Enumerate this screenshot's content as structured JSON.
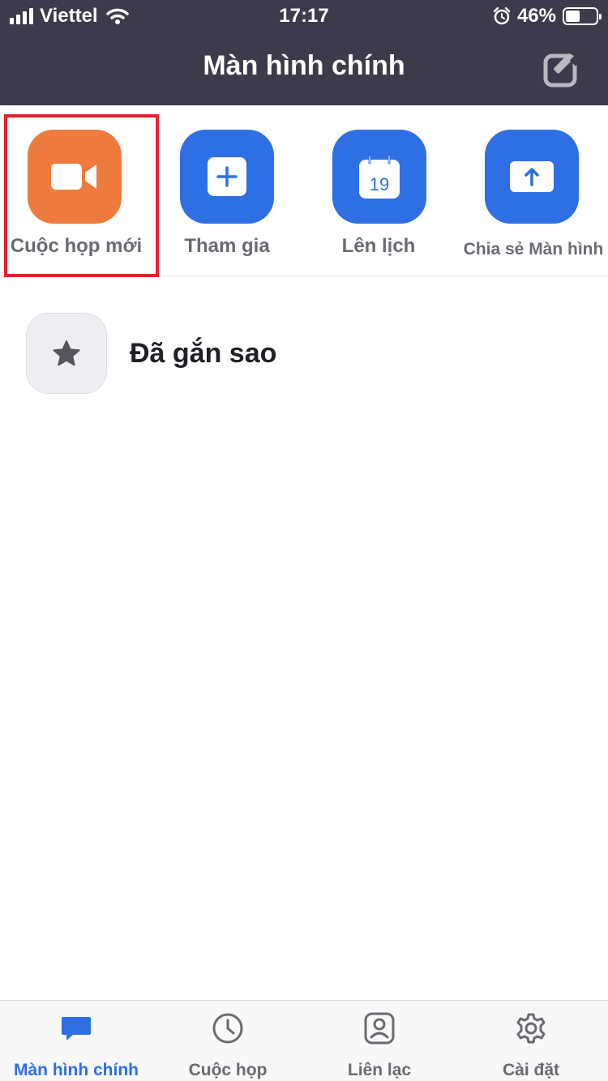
{
  "status_bar": {
    "carrier": "Viettel",
    "time": "17:17",
    "battery_percent": "46%",
    "battery_level": 0.46,
    "signal_icon": "signal-bars-icon",
    "wifi_icon": "wifi-icon",
    "alarm_icon": "alarm-icon"
  },
  "header": {
    "title": "Màn hình chính",
    "edit_icon": "edit-compose-icon"
  },
  "actions": [
    {
      "label": "Cuộc họp mới",
      "icon": "video-camera-icon",
      "color": "#ee7a3e"
    },
    {
      "label": "Tham gia",
      "icon": "plus-icon",
      "color": "#2f6fe4"
    },
    {
      "label": "Lên lịch",
      "icon": "calendar-icon",
      "color": "#2f6fe4",
      "calendar_day": "19"
    },
    {
      "label": "Chia sẻ Màn hình",
      "icon": "share-upload-icon",
      "color": "#2f6fe4"
    }
  ],
  "starred": {
    "label": "Đã gắn sao",
    "icon": "star-icon"
  },
  "tabs": [
    {
      "label": "Màn hình chính",
      "icon": "chat-bubble-icon",
      "active": true
    },
    {
      "label": "Cuộc họp",
      "icon": "clock-icon",
      "active": false
    },
    {
      "label": "Liên lạc",
      "icon": "contact-icon",
      "active": false
    },
    {
      "label": "Cài đặt",
      "icon": "gear-icon",
      "active": false
    }
  ],
  "colors": {
    "header_bg": "#3b3b4b",
    "accent_blue": "#2f6fe4",
    "accent_orange": "#ee7a3e",
    "highlight_red": "#e8202a",
    "tab_active": "#2d6fe0"
  }
}
